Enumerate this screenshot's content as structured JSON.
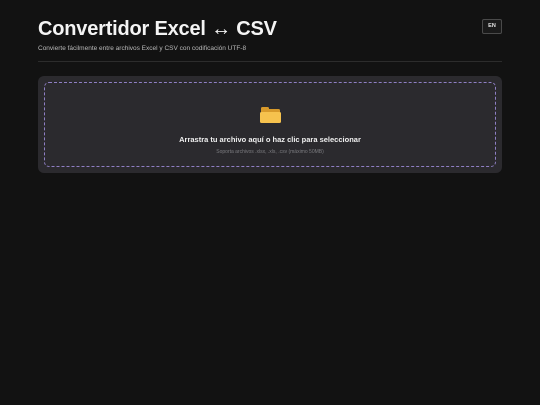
{
  "header": {
    "title": "Convertidor Excel ↔ CSV",
    "subtitle": "Convierte fácilmente entre archivos Excel y CSV con codificación UTF-8",
    "language_button": "EN"
  },
  "dropzone": {
    "icon": "folder-icon",
    "title": "Arrastra tu archivo aquí o haz clic para seleccionar",
    "hint": "Soporta archivos .xlsx, .xls, .csv (máximo 50MB)"
  },
  "colors": {
    "background": "#121212",
    "card": "#2b2a2e",
    "dashed_border": "#8f7fc4",
    "folder": "#f6c24e"
  }
}
